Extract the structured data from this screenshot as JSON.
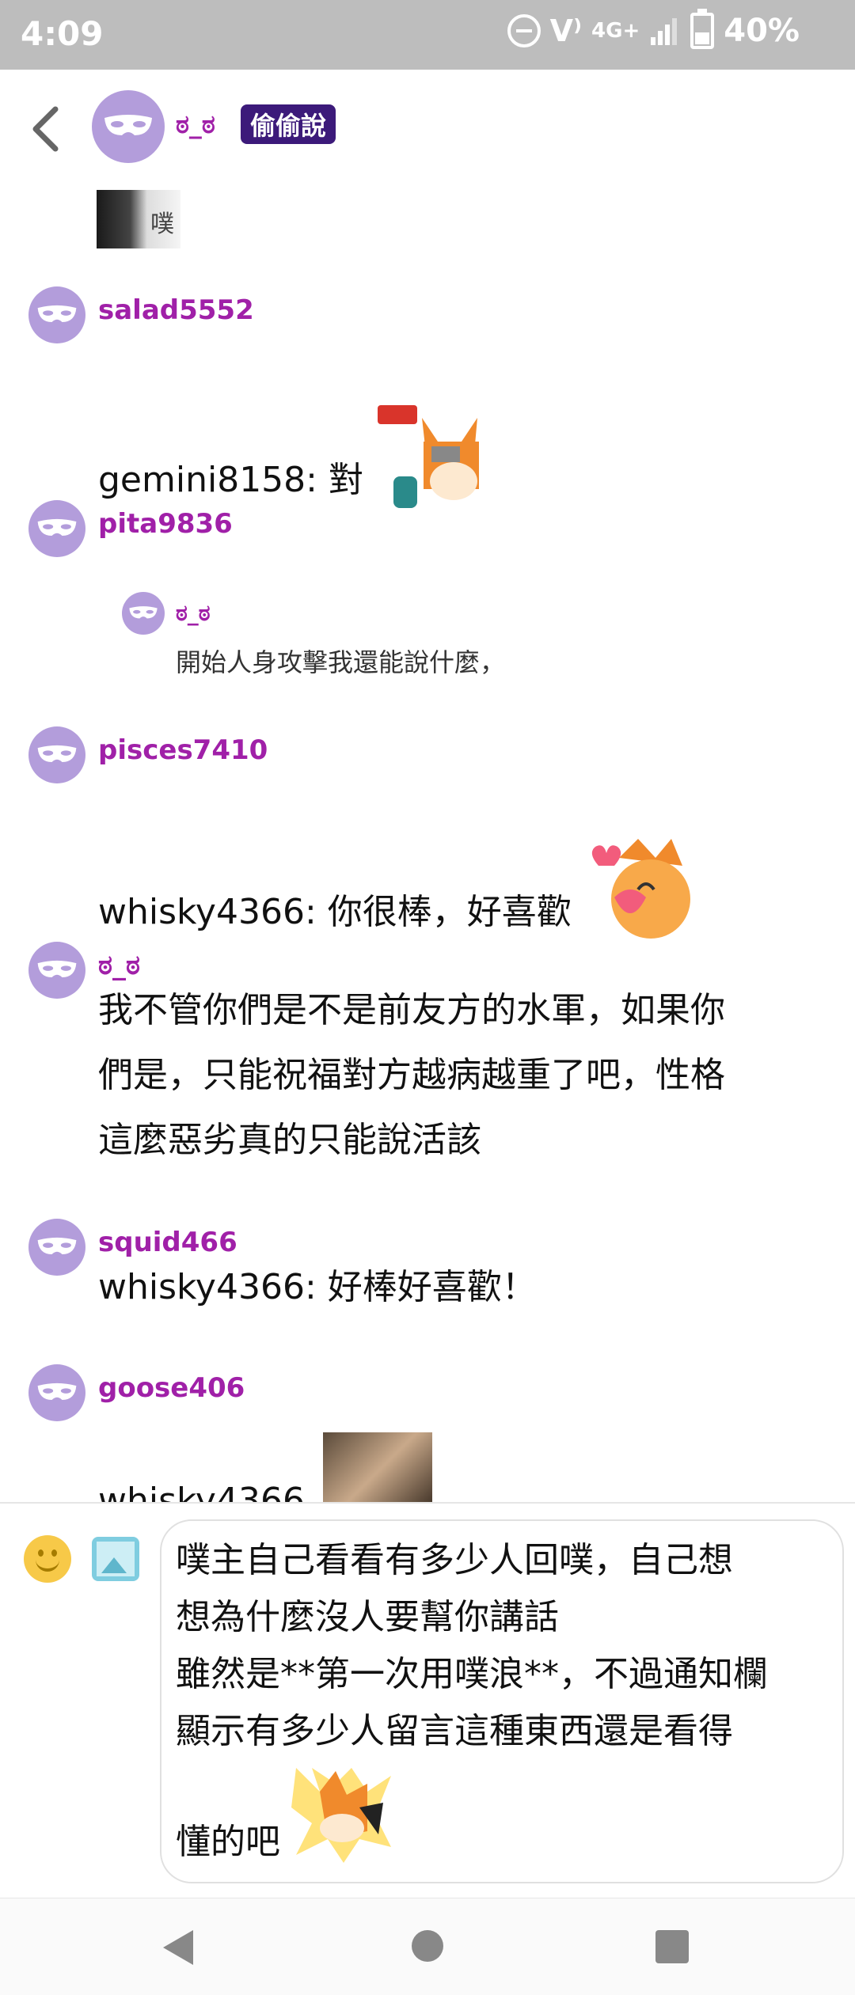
{
  "status_bar": {
    "time": "4:09",
    "network": "4G+",
    "battery": "40%"
  },
  "header": {
    "author": "ಠ_ಠ",
    "badge": "偷偷說"
  },
  "thumbnail": {
    "text": "噗"
  },
  "responses": [
    {
      "user": "salad5552",
      "text": "gemini8158: 對"
    },
    {
      "user": "pita9836",
      "quote_user": "ಠ_ಠ",
      "quote_text": "開始人身攻擊我還能說什麼，"
    },
    {
      "user": "pisces7410",
      "text": "whisky4366: 你很棒，好喜歡"
    },
    {
      "user": "ಠ_ಠ",
      "lines": [
        "我不管你們是不是前友方的水軍，如果你",
        "們是，只能祝福對方越病越重了吧，性格",
        "這麼惡劣真的只能說活該"
      ]
    },
    {
      "user": "squid466",
      "text": "whisky4366: 好棒好喜歡！"
    },
    {
      "user": "goose406",
      "text": "whisky4366"
    }
  ],
  "composer": {
    "text": "噗主自己看看有多少人回噗，自己想\n想為什麼沒人要幫你講話\n雖然是**第一次用噗浪**，不過通知欄\n顯示有多少人留言這種東西還是看得",
    "last_line": "懂的吧"
  },
  "colors": {
    "username": "#a020a8",
    "avatar": "#b39ddb",
    "badge_bg": "#3c1a7a"
  },
  "icons": [
    "back-arrow-icon",
    "mask-icon",
    "emoji-icon",
    "image-icon",
    "nav-back-icon",
    "nav-home-icon",
    "nav-recent-icon"
  ]
}
